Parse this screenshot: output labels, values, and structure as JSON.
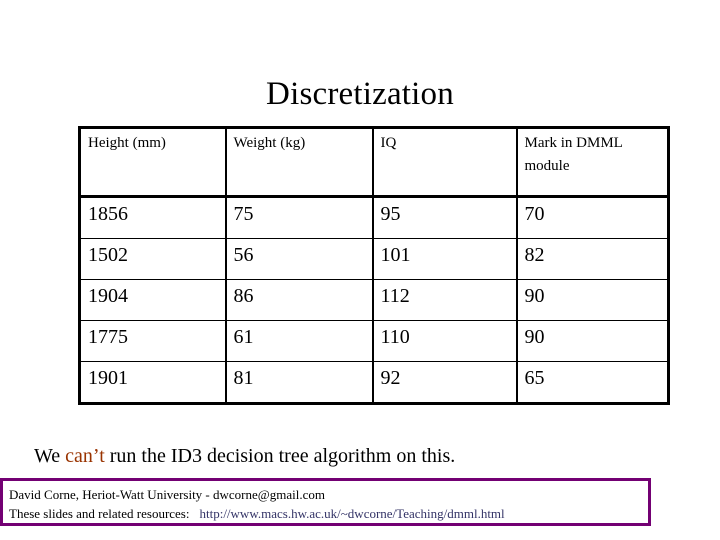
{
  "slide": {
    "title": "Discretization",
    "caption": {
      "before": "We ",
      "emphasis": "can’t",
      "after": " run the ID3 decision tree algorithm on this.",
      "emphasis_color": "#993300"
    },
    "footer": {
      "line1": "David Corne,  Heriot-Watt University  -  dwcorne@gmail.com",
      "line2_label": "These slides and related resources:",
      "line2_url": "http://www.macs.hw.ac.uk/~dwcorne/Teaching/dmml.html",
      "border_color": "#730073",
      "url_color": "#333366"
    }
  },
  "chart_data": {
    "type": "table",
    "title": "Discretization",
    "columns": [
      "Height (mm)",
      "Weight (kg)",
      "IQ",
      "Mark in DMML module"
    ],
    "rows": [
      [
        "1856",
        "75",
        "95",
        "70"
      ],
      [
        "1502",
        "56",
        "101",
        "82"
      ],
      [
        "1904",
        "86",
        "112",
        "90"
      ],
      [
        "1775",
        "61",
        "110",
        "90"
      ],
      [
        "1901",
        "81",
        "92",
        "65"
      ]
    ]
  }
}
